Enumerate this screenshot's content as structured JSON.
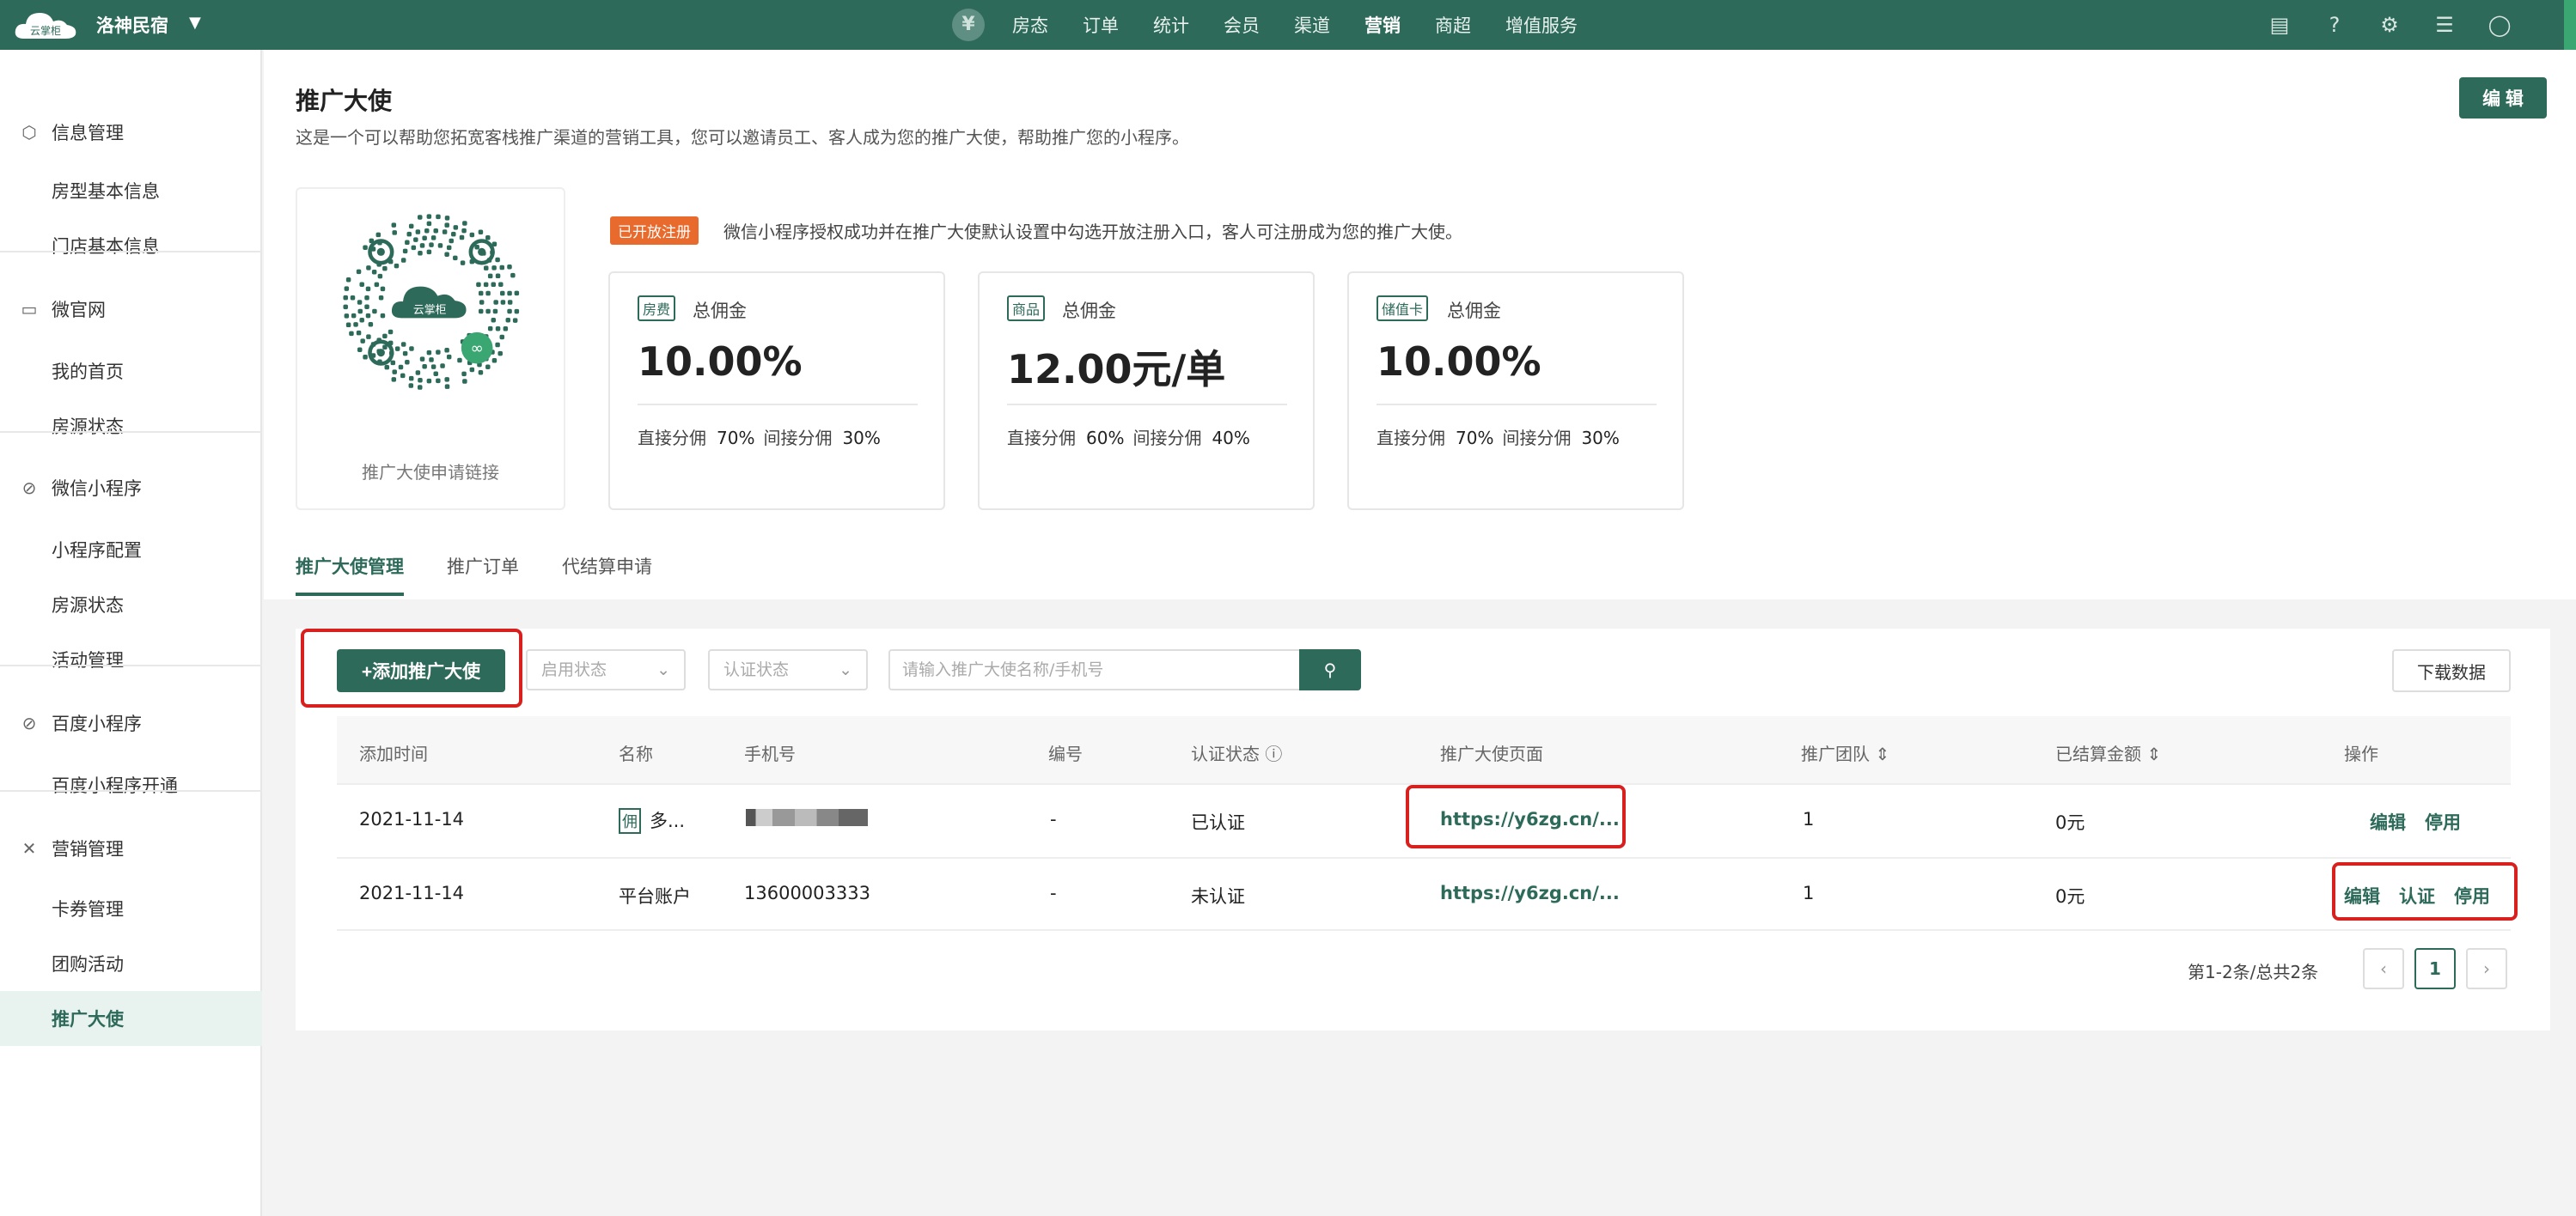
{
  "topbar": {
    "logo_text": "云掌柜",
    "store_name": "洛神民宿",
    "nav": [
      "房态",
      "订单",
      "统计",
      "会员",
      "渠道",
      "营销",
      "商超",
      "增值服务"
    ],
    "active_nav": "营销",
    "icons": [
      "message-icon",
      "help-icon",
      "gear-icon",
      "menu-icon",
      "user-icon"
    ]
  },
  "sidebar": {
    "groups": [
      {
        "label": "信息管理",
        "icon": "cube-icon",
        "items": [
          "房型基本信息",
          "门店基本信息"
        ]
      },
      {
        "label": "微官网",
        "icon": "monitor-icon",
        "items": [
          "我的首页",
          "房源状态"
        ]
      },
      {
        "label": "微信小程序",
        "icon": "miniapp-icon",
        "items": [
          "小程序配置",
          "房源状态",
          "活动管理"
        ]
      },
      {
        "label": "百度小程序",
        "icon": "miniapp-icon",
        "items": [
          "百度小程序开通"
        ]
      },
      {
        "label": "营销管理",
        "icon": "megaphone-icon",
        "items": [
          "卡券管理",
          "团购活动",
          "推广大使"
        ]
      }
    ],
    "active_item": "推广大使"
  },
  "page": {
    "title": "推广大使",
    "description": "这是一个可以帮助您拓宽客栈推广渠道的营销工具，您可以邀请员工、客人成为您的推广大使，帮助推广您的小程序。",
    "edit_label": "编 辑",
    "qr_logo_text": "云掌柜",
    "qr_caption": "推广大使申请链接",
    "registration_tag": "已开放注册",
    "registration_text": "微信小程序授权成功并在推广大使默认设置中勾选开放注册入口，客人可注册成为您的推广大使。"
  },
  "stats": [
    {
      "tag": "房费",
      "label": "总佣金",
      "value": "10.00%",
      "direct_label": "直接分佣",
      "direct": "70%",
      "indirect_label": "间接分佣",
      "indirect": "30%"
    },
    {
      "tag": "商品",
      "label": "总佣金",
      "value": "12.00元/单",
      "direct_label": "直接分佣",
      "direct": "60%",
      "indirect_label": "间接分佣",
      "indirect": "40%"
    },
    {
      "tag": "储值卡",
      "label": "总佣金",
      "value": "10.00%",
      "direct_label": "直接分佣",
      "direct": "70%",
      "indirect_label": "间接分佣",
      "indirect": "30%"
    }
  ],
  "tabs": [
    "推广大使管理",
    "推广订单",
    "代结算申请"
  ],
  "toolbar": {
    "add_label": "+添加推广大使",
    "status_placeholder": "启用状态",
    "auth_placeholder": "认证状态",
    "search_placeholder": "请输入推广大使名称/手机号",
    "download_label": "下载数据"
  },
  "table": {
    "headers": [
      "添加时间",
      "名称",
      "手机号",
      "编号",
      "认证状态",
      "推广大使页面",
      "推广团队",
      "已结算金额",
      "操作"
    ],
    "rows": [
      {
        "date": "2021-11-14",
        "name_icon": "佣",
        "name": "多...",
        "phone": "",
        "number": "-",
        "auth": "已认证",
        "page": "https://y6zg.cn/...",
        "team": "1",
        "settled": "0元",
        "ops": [
          "编辑",
          "停用"
        ]
      },
      {
        "date": "2021-11-14",
        "name_icon": "",
        "name": "平台账户",
        "phone": "13600003333",
        "number": "-",
        "auth": "未认证",
        "page": "https://y6zg.cn/...",
        "team": "1",
        "settled": "0元",
        "ops": [
          "编辑",
          "认证",
          "停用"
        ]
      }
    ]
  },
  "pager": {
    "summary": "第1-2条/总共2条",
    "current": "1",
    "prev": "‹",
    "next": "›"
  },
  "colors": {
    "brand": "#2e6a5a",
    "highlight": "#d8201f",
    "tag_orange": "#e86a2c"
  }
}
